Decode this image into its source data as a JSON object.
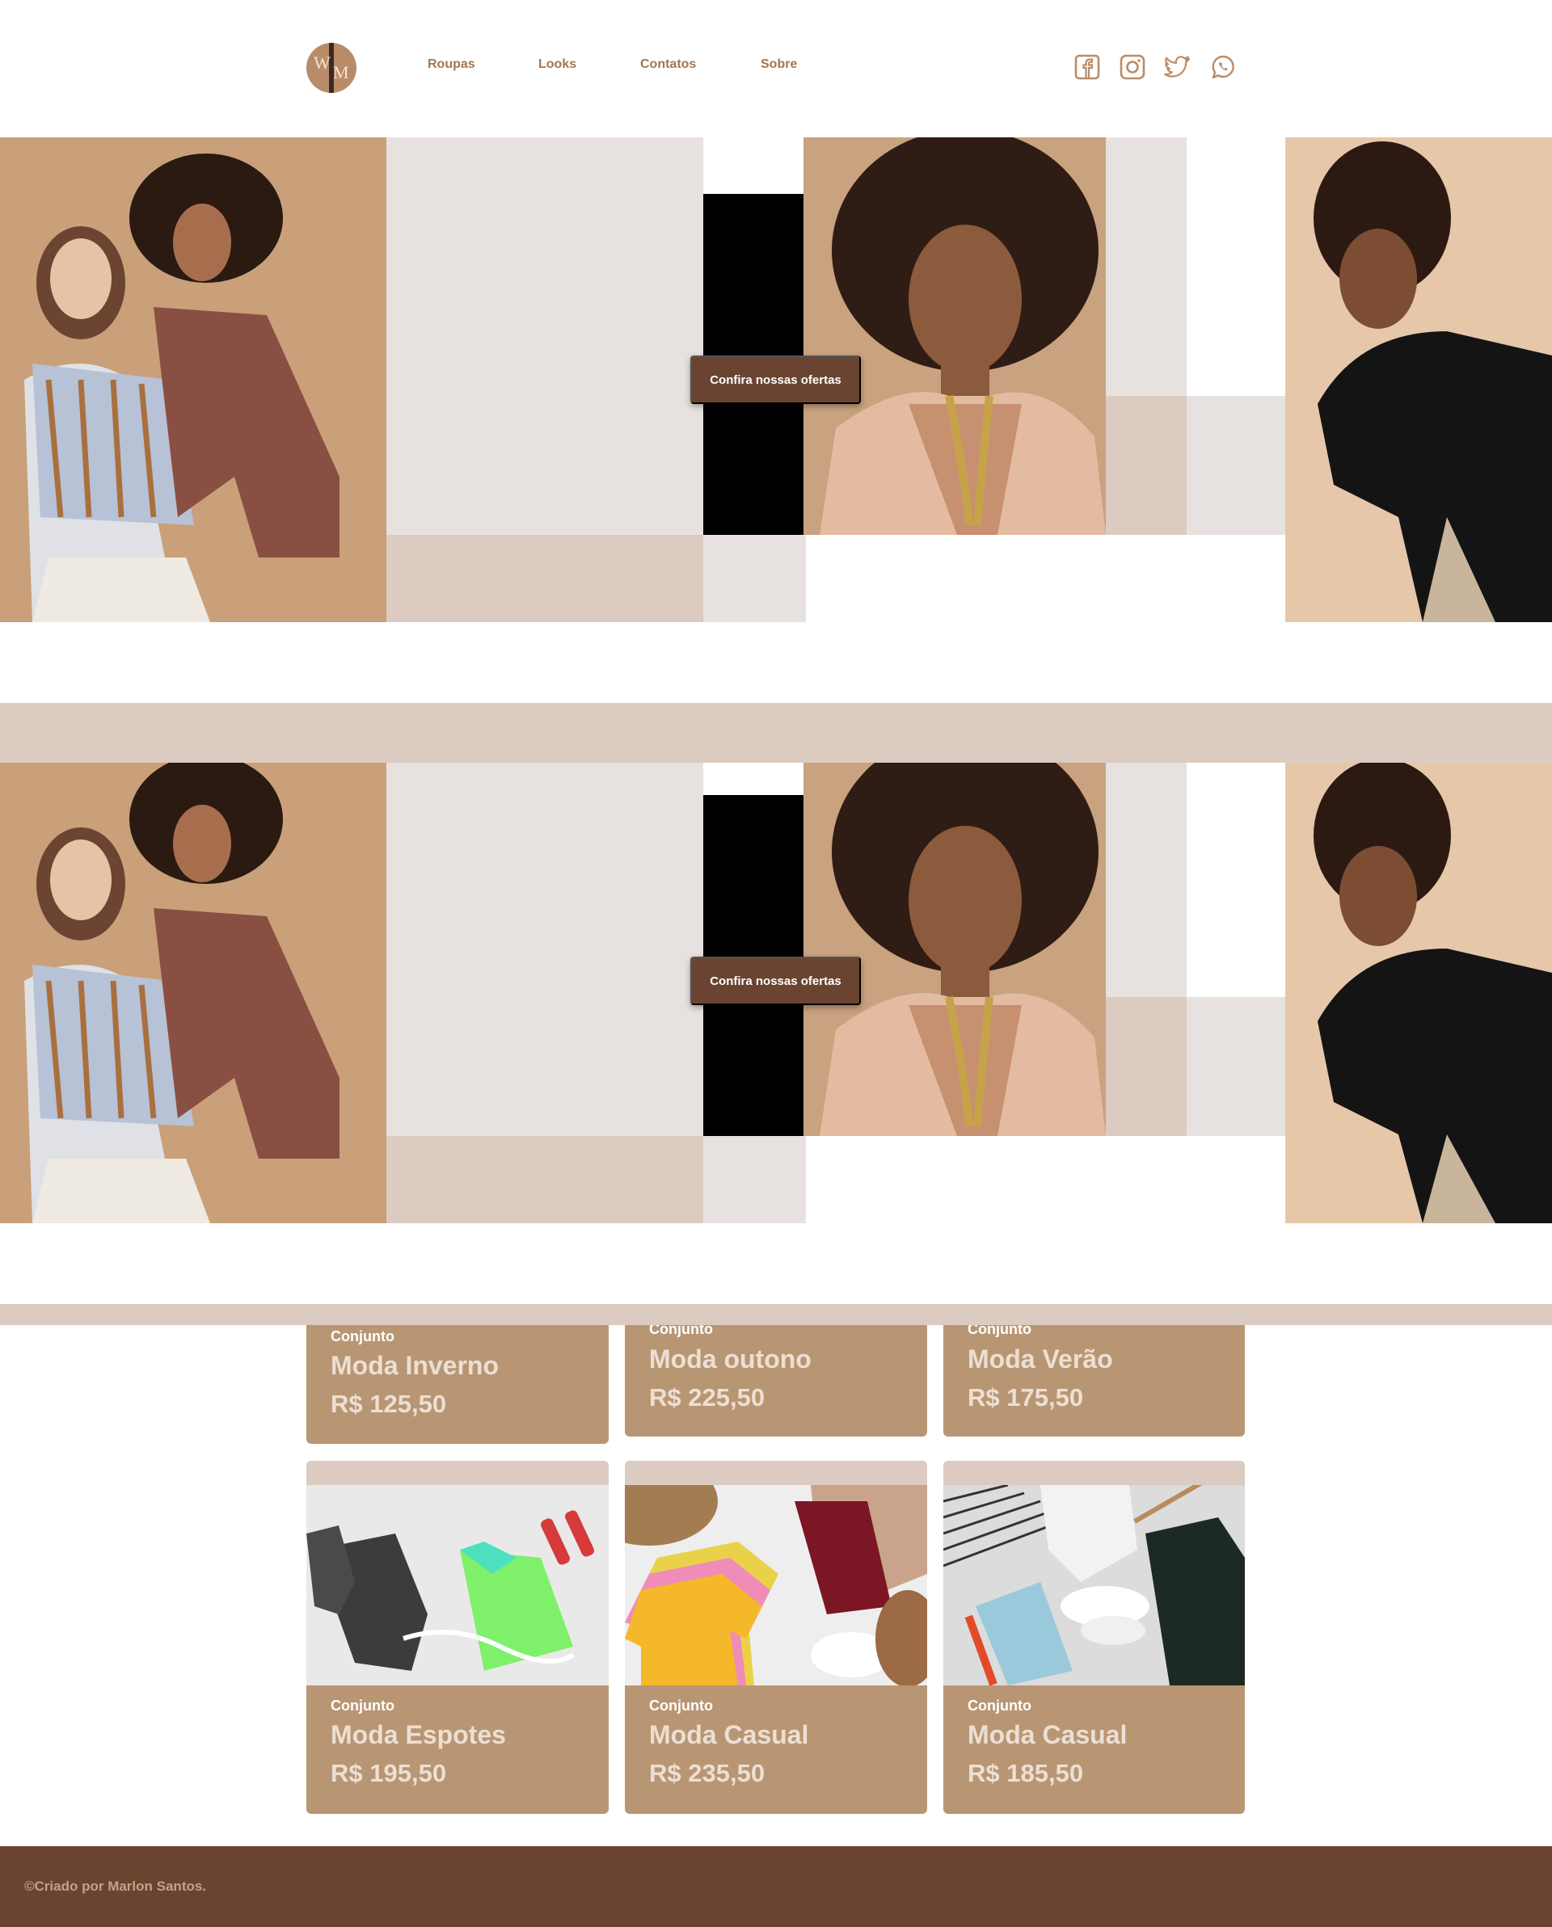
{
  "header": {
    "logo_letters": [
      "W",
      "M"
    ],
    "nav": [
      "Roupas",
      "Looks",
      "Contatos",
      "Sobre"
    ],
    "social_icons": [
      "facebook-icon",
      "instagram-icon",
      "twitter-icon",
      "whatsapp-icon"
    ]
  },
  "hero": {
    "cta_label": "Confira nossas ofertas"
  },
  "hero2": {
    "cta_label": "Confira nossas ofertas"
  },
  "products": [
    {
      "kind": "Conjunto",
      "name": "Moda Inverno",
      "price": "R$ 125,50"
    },
    {
      "kind": "Conjunto",
      "name": "Moda outono",
      "price": "R$ 225,50"
    },
    {
      "kind": "Conjunto",
      "name": "Moda Verão",
      "price": "R$ 175,50"
    },
    {
      "kind": "Conjunto",
      "name": "Moda Espotes",
      "price": "R$ 195,50"
    },
    {
      "kind": "Conjunto",
      "name": "Moda Casual",
      "price": "R$ 235,50"
    },
    {
      "kind": "Conjunto",
      "name": "Moda Casual",
      "price": "R$ 185,50"
    }
  ],
  "footer": {
    "credit": "©Criado por Marlon Santos."
  },
  "colors": {
    "brand_brown": "#6b4431",
    "card_tan": "#b99673",
    "stripe_pink": "#dccbc1",
    "nav_text": "#a4764f"
  }
}
